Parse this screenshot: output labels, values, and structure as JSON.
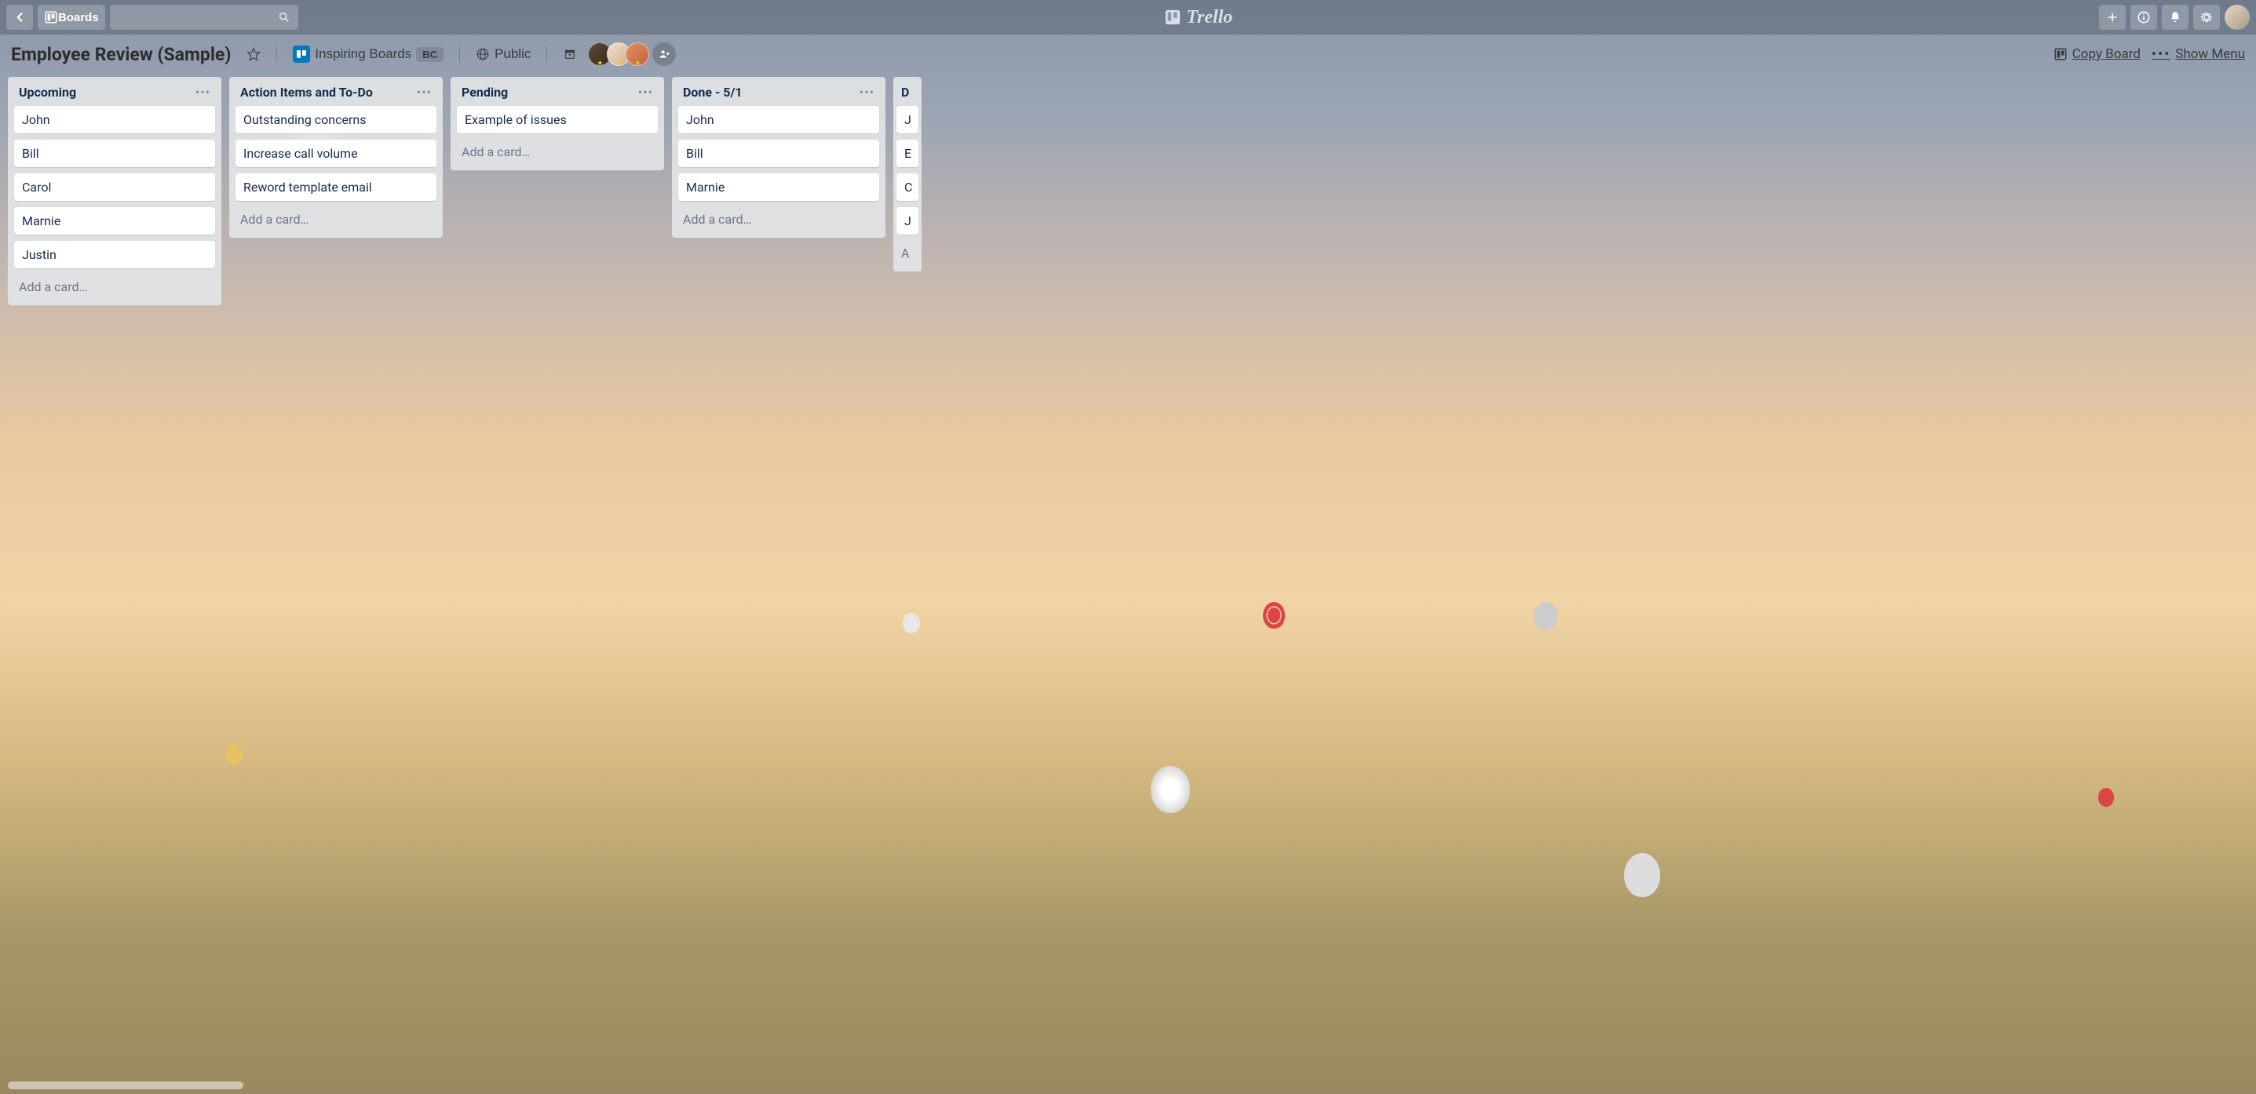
{
  "header": {
    "boards_label": "Boards",
    "logo_text": "Trello"
  },
  "board": {
    "title": "Employee Review (Sample)",
    "team_name": "Inspiring Boards",
    "team_badge": "BC",
    "visibility": "Public",
    "copy_label": "Copy Board",
    "menu_label": "Show Menu"
  },
  "lists": [
    {
      "title": "Upcoming",
      "cards": [
        "John",
        "Bill",
        "Carol",
        "Marnie",
        "Justin"
      ],
      "add_label": "Add a card…"
    },
    {
      "title": "Action Items and To-Do",
      "cards": [
        "Outstanding concerns",
        "Increase call volume",
        "Reword template email"
      ],
      "add_label": "Add a card…"
    },
    {
      "title": "Pending",
      "cards": [
        "Example of issues"
      ],
      "add_label": "Add a card…"
    },
    {
      "title": "Done - 5/1",
      "cards": [
        "John",
        "Bill",
        "Marnie"
      ],
      "add_label": "Add a card…"
    },
    {
      "title": "D",
      "cards": [
        "J",
        "E",
        "C",
        "J"
      ],
      "add_label": "A"
    }
  ]
}
